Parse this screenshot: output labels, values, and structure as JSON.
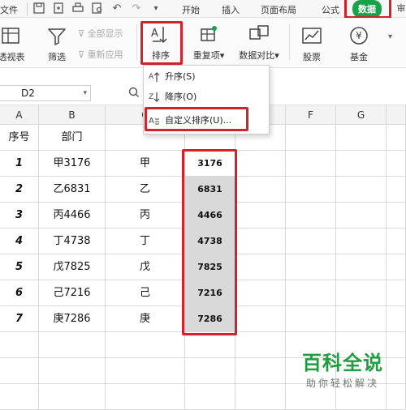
{
  "menubar": {
    "file_label": "文件",
    "tabs": [
      "开始",
      "插入",
      "页面布局",
      "公式",
      "数据"
    ],
    "active_tab": "数据",
    "active_color": "#16a34a"
  },
  "ribbon": {
    "pivot_label": "透视表",
    "filter_label": "筛选",
    "show_all_label": "全部显示",
    "reapply_label": "重新应用",
    "sort_label": "排序",
    "duplicates_label": "重复项",
    "compare_label": "数据对比",
    "stock_label": "股票",
    "fund_label": "基金",
    "fund_symbol": "¥"
  },
  "formula_bar": {
    "cell_ref": "D2"
  },
  "sort_menu": {
    "ascending": "升序(S)",
    "descending": "降序(O)",
    "custom": "自定义排序(U)..."
  },
  "sheet": {
    "columns": [
      "A",
      "B",
      "C",
      "D",
      "E",
      "F",
      "G"
    ],
    "header_row": [
      "序号",
      "部门",
      "",
      ""
    ],
    "rows": [
      {
        "index": "1",
        "dept": "甲3176",
        "stem": "甲",
        "value": "3176"
      },
      {
        "index": "2",
        "dept": "乙6831",
        "stem": "乙",
        "value": "6831"
      },
      {
        "index": "3",
        "dept": "丙4466",
        "stem": "丙",
        "value": "4466"
      },
      {
        "index": "4",
        "dept": "丁4738",
        "stem": "丁",
        "value": "4738"
      },
      {
        "index": "5",
        "dept": "戊7825",
        "stem": "戊",
        "value": "7825"
      },
      {
        "index": "6",
        "dept": "己7216",
        "stem": "己",
        "value": "7216"
      },
      {
        "index": "7",
        "dept": "庚7286",
        "stem": "庚",
        "value": "7286"
      }
    ],
    "highlight_color": "#d2232a"
  },
  "watermark": {
    "title": "百科全说",
    "subtitle": "助你轻松解决"
  }
}
